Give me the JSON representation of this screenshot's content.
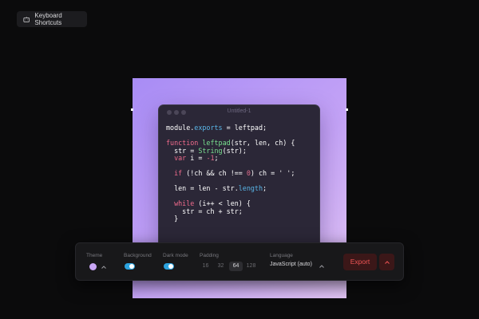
{
  "shortcuts_button": {
    "label": "Keyboard Shortcuts",
    "icon": "keyboard-icon"
  },
  "editor": {
    "title": "Untitled-1",
    "code_lines": [
      [
        [
          "module.",
          ""
        ],
        [
          "exports",
          "prop"
        ],
        [
          " = leftpad;",
          ""
        ]
      ],
      [],
      [
        [
          "function ",
          "kw"
        ],
        [
          "leftpad",
          "fn"
        ],
        [
          "(str, len, ch) {",
          ""
        ]
      ],
      [
        [
          "  str = ",
          ""
        ],
        [
          "String",
          "fn"
        ],
        [
          "(str);",
          ""
        ]
      ],
      [
        [
          "  ",
          ""
        ],
        [
          "var",
          "kw"
        ],
        [
          " i = ",
          ""
        ],
        [
          "-1",
          "num"
        ],
        [
          ";",
          ""
        ]
      ],
      [],
      [
        [
          "  ",
          ""
        ],
        [
          "if",
          "kw"
        ],
        [
          " (!ch && ch !== ",
          ""
        ],
        [
          "0",
          "num"
        ],
        [
          ") ch = ",
          ""
        ],
        [
          "' '",
          "str"
        ],
        [
          ";",
          ""
        ]
      ],
      [],
      [
        [
          "  len = len - str.",
          ""
        ],
        [
          "length",
          "prop"
        ],
        [
          ";",
          ""
        ]
      ],
      [],
      [
        [
          "  ",
          ""
        ],
        [
          "while",
          "kw"
        ],
        [
          " (i++ < len) {",
          ""
        ]
      ],
      [
        [
          "    str = ch + str;",
          ""
        ]
      ],
      [
        [
          "  }",
          ""
        ]
      ]
    ]
  },
  "toolbar": {
    "theme_label": "Theme",
    "theme_color": "#c9a6f5",
    "background_label": "Background",
    "background_on": true,
    "dark_mode_label": "Dark mode",
    "dark_mode_on": true,
    "padding_label": "Padding",
    "padding_options": [
      "16",
      "32",
      "64",
      "128"
    ],
    "padding_selected": "64",
    "language_label": "Language",
    "language_value": "JavaScript (auto)",
    "export_label": "Export"
  },
  "colors": {
    "accent_toggle": "#2ca3df",
    "export_text": "#f15555",
    "export_bg": "#3b1718"
  }
}
